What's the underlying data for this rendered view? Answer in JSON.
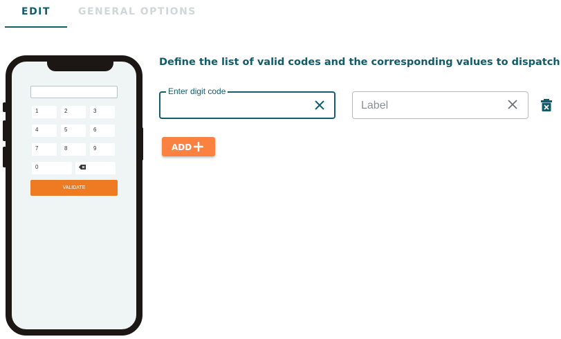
{
  "tabs": [
    {
      "label": "EDIT",
      "active": true
    },
    {
      "label": "GENERAL OPTIONS",
      "active": false
    }
  ],
  "preview": {
    "keys": [
      "1",
      "2",
      "3",
      "4",
      "5",
      "6",
      "7",
      "8",
      "9",
      "0"
    ],
    "backspace_icon": "backspace-icon",
    "validate_label": "VALIDATE"
  },
  "panel": {
    "heading": "Define the list of valid codes and the corresponding values to dispatch",
    "code_field": {
      "label": "Enter digit code",
      "value": ""
    },
    "label_field": {
      "placeholder": "Label",
      "value": ""
    },
    "add_button": {
      "label": "ADD"
    }
  },
  "colors": {
    "primary": "#0f5d6b",
    "accent_orange": "#fa8140",
    "validate_orange": "#ee7b22"
  }
}
